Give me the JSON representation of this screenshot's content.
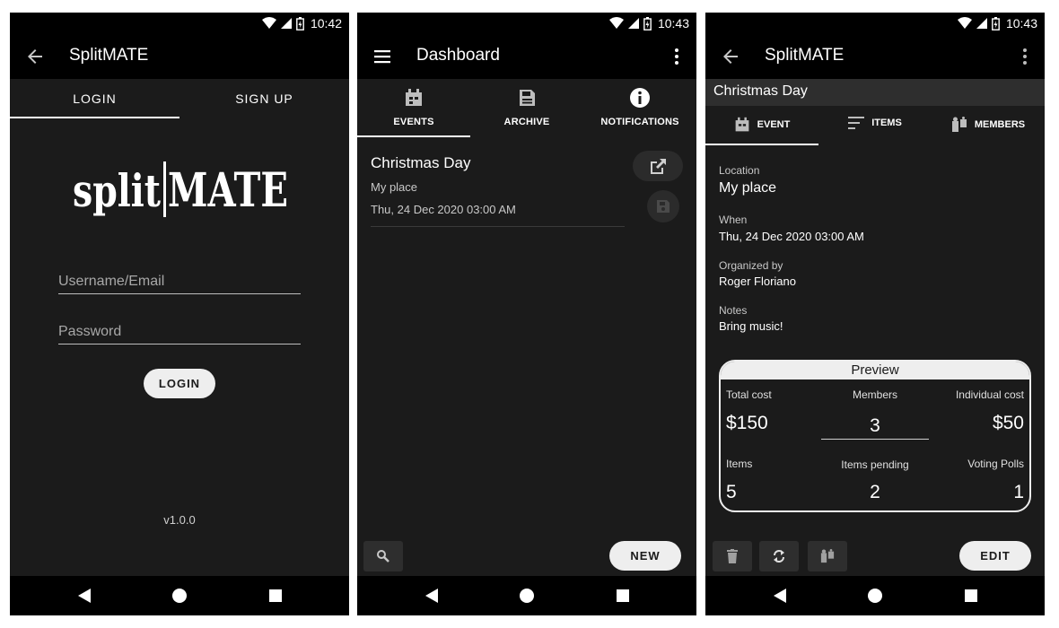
{
  "screen1": {
    "status_time": "10:42",
    "title": "SplitMATE",
    "tabs": [
      "LOGIN",
      "SIGN UP"
    ],
    "logo_left": "split",
    "logo_right": "MATE",
    "username_placeholder": "Username/Email",
    "password_placeholder": "Password",
    "login_button": "LOGIN",
    "version": "v1.0.0"
  },
  "screen2": {
    "status_time": "10:43",
    "title": "Dashboard",
    "tabs": [
      {
        "label": "EVENTS",
        "icon": "calendar-icon"
      },
      {
        "label": "ARCHIVE",
        "icon": "archive-save-icon"
      },
      {
        "label": "NOTIFICATIONS",
        "icon": "info-icon"
      }
    ],
    "event": {
      "title": "Christmas Day",
      "location": "My place",
      "date": "Thu, 24 Dec 2020 03:00 AM"
    },
    "new_button": "NEW"
  },
  "screen3": {
    "status_time": "10:43",
    "title": "SplitMATE",
    "header": "Christmas Day",
    "tabs": [
      {
        "label": "EVENT",
        "icon": "calendar-icon"
      },
      {
        "label": "ITEMS",
        "icon": "list-icon"
      },
      {
        "label": "MEMBERS",
        "icon": "members-icon"
      }
    ],
    "details": {
      "location_label": "Location",
      "location_value": "My place",
      "when_label": "When",
      "when_value": "Thu, 24 Dec 2020 03:00 AM",
      "organized_label": "Organized by",
      "organized_value": "Roger Floriano",
      "notes_label": "Notes",
      "notes_value": "Bring music!"
    },
    "preview": {
      "title": "Preview",
      "total_cost_label": "Total cost",
      "total_cost": "$150",
      "members_label": "Members",
      "members": "3",
      "individual_cost_label": "Individual cost",
      "individual_cost": "$50",
      "items_label": "Items",
      "items": "5",
      "items_pending_label": "Items pending",
      "items_pending": "2",
      "voting_polls_label": "Voting Polls",
      "voting_polls": "1"
    },
    "edit_button": "EDIT"
  },
  "colors": {
    "background": "#1b1b1b",
    "bars": "#000000",
    "pill": "#eeeeee"
  }
}
